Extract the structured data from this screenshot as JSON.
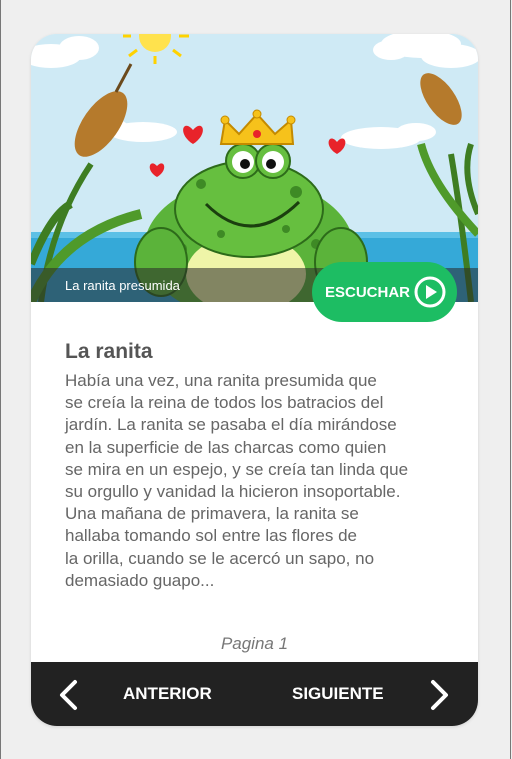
{
  "hero": {
    "caption": "La ranita presumida",
    "image_name": "frog-prince-illustration"
  },
  "audio": {
    "listen_label": "ESCUCHAR",
    "icon": "play-circle-icon"
  },
  "story": {
    "title": "La ranita",
    "lines": [
      "Había una vez, una ranita presumida que",
      "se creía la reina de todos los batracios del",
      "jardín. La ranita se pasaba el día mirándose",
      "en la superficie de las charcas como quien",
      "se mira en un espejo, y se creía tan linda que",
      "su orgullo y vanidad la hicieron insoportable.",
      "Una mañana de primavera, la ranita se",
      "hallaba tomando sol entre las flores de",
      "la orilla, cuando se le acercó un sapo, no",
      "demasiado guapo..."
    ]
  },
  "pagination": {
    "page_label": "Pagina 1"
  },
  "nav": {
    "prev_label": "ANTERIOR",
    "next_label": "SIGUIENTE",
    "prev_icon": "chevron-left-icon",
    "next_icon": "chevron-right-icon"
  },
  "colors": {
    "accent": "#1dbd63",
    "nav_background": "#222222",
    "page_background": "#efefef"
  }
}
